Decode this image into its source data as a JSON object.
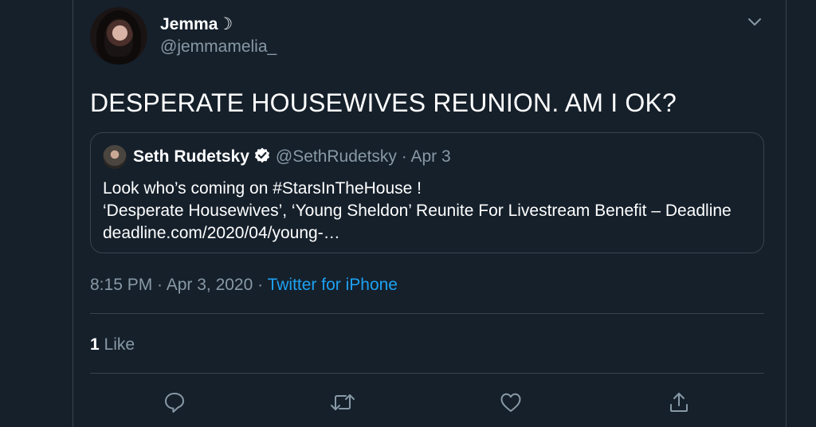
{
  "tweet": {
    "author": {
      "display_name": "Jemma☽",
      "handle": "@jemmamelia_"
    },
    "text": "DESPERATE HOUSEWIVES REUNION. AM I OK?",
    "quoted": {
      "display_name": "Seth Rudetsky",
      "handle": "@SethRudetsky",
      "separator": "·",
      "date": "Apr 3",
      "lines": [
        "Look who’s coming on #StarsInTheHouse !",
        "‘Desperate Housewives’, ‘Young Sheldon’ Reunite For Livestream Benefit – Deadline",
        "deadline.com/2020/04/young-…"
      ]
    },
    "timestamp": "8:15 PM · Apr 3, 2020 · ",
    "source": "Twitter for iPhone",
    "likes_count": "1",
    "likes_label": " Like"
  },
  "icons": {
    "caret": "chevron-down-icon",
    "verified": "verified-badge-icon",
    "reply": "reply-icon",
    "retweet": "retweet-icon",
    "like": "heart-icon",
    "share": "share-icon"
  },
  "colors": {
    "background": "#15202b",
    "border": "#38444d",
    "secondary_text": "#8899a6",
    "accent": "#1da1f2"
  }
}
